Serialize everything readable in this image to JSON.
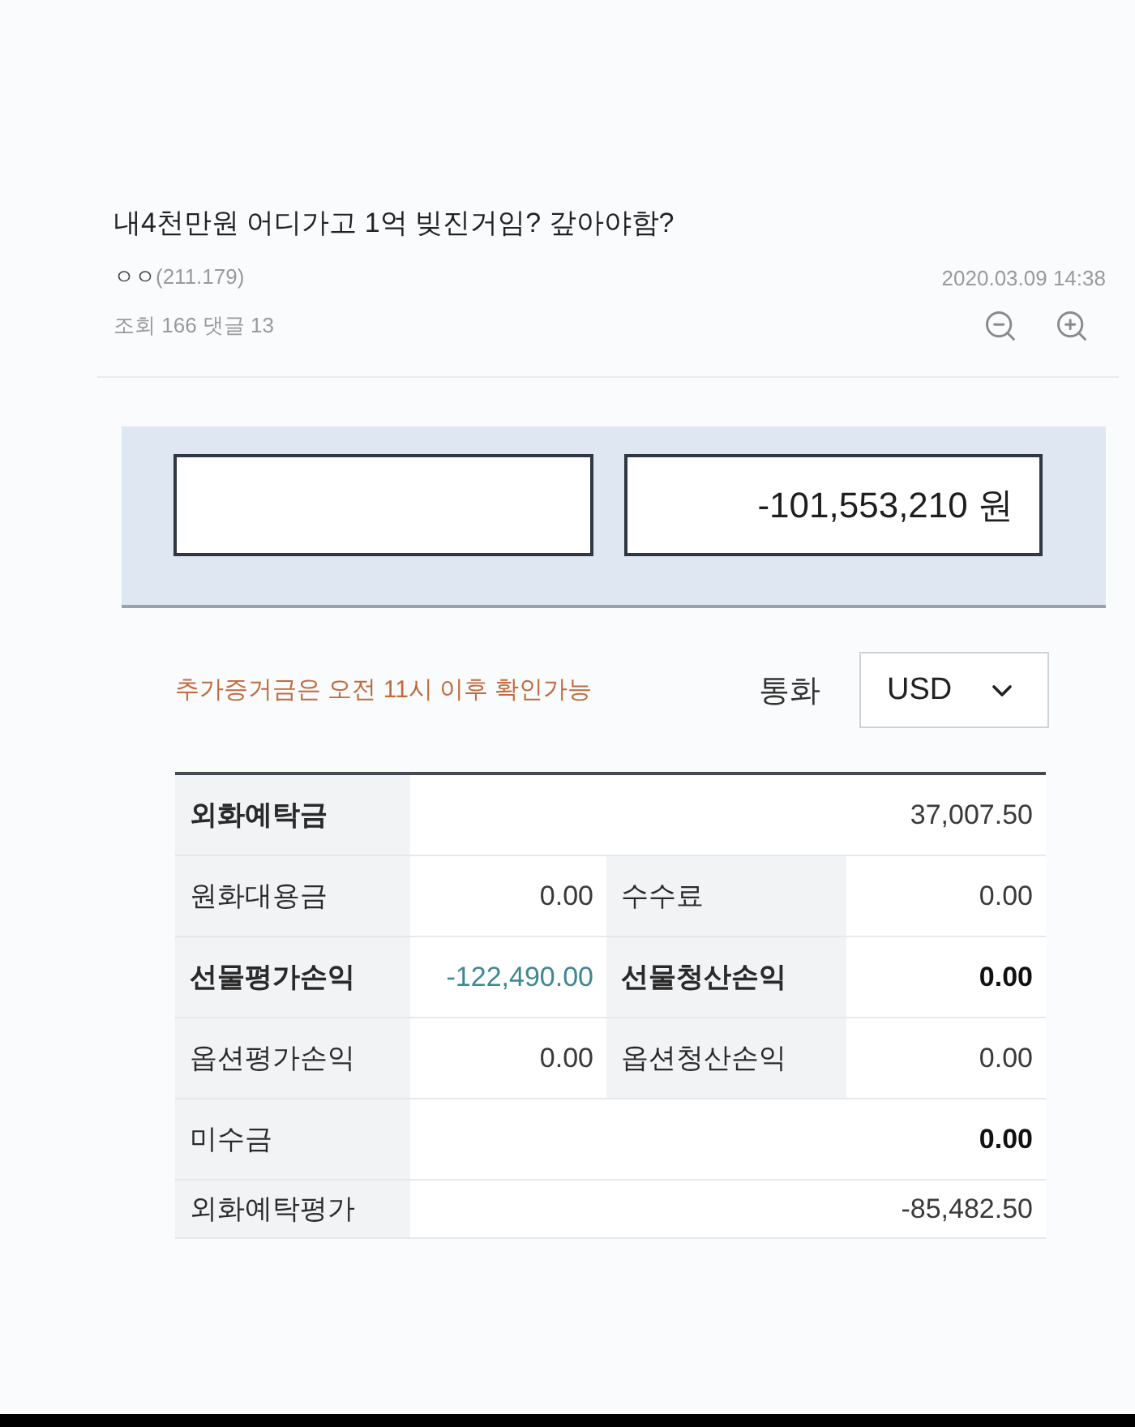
{
  "post": {
    "title": "내4천만원 어디가고 1억 빚진거임? 갚아야함?",
    "author": "ㅇㅇ",
    "ip": "(211.179)",
    "date": "2020.03.09 14:38",
    "stats": "조회 166 댓글 13"
  },
  "summary": {
    "amount": "-101,553,210 원"
  },
  "notice": "추가증거금은 오전 11시 이후 확인가능",
  "currency": {
    "label": "통화",
    "value": "USD"
  },
  "table": {
    "rows": [
      {
        "kind": "wide",
        "cells": [
          {
            "label": "외화예탁금",
            "label_bold": true,
            "value": "37,007.50",
            "value_bold": false
          }
        ]
      },
      {
        "kind": "pair",
        "cells": [
          {
            "label": "원화대용금",
            "label_bold": false,
            "value": "0.00",
            "value_bold": false
          },
          {
            "label": "수수료",
            "label_bold": false,
            "value": "0.00",
            "value_bold": false
          }
        ]
      },
      {
        "kind": "pair",
        "cells": [
          {
            "label": "선물평가손익",
            "label_bold": true,
            "value": "-122,490.00",
            "value_bold": false,
            "color": "#3f8893"
          },
          {
            "label": "선물청산손익",
            "label_bold": true,
            "value": "0.00",
            "value_bold": true
          }
        ]
      },
      {
        "kind": "pair",
        "cells": [
          {
            "label": "옵션평가손익",
            "label_bold": false,
            "value": "0.00",
            "value_bold": false
          },
          {
            "label": "옵션청산손익",
            "label_bold": false,
            "value": "0.00",
            "value_bold": false
          }
        ]
      },
      {
        "kind": "wide",
        "cells": [
          {
            "label": "미수금",
            "label_bold": false,
            "value": "0.00",
            "value_bold": true
          }
        ]
      },
      {
        "kind": "wide",
        "cells": [
          {
            "label": "외화예탁평가",
            "label_bold": false,
            "value": "-85,482.50",
            "value_bold": false
          }
        ]
      }
    ]
  }
}
